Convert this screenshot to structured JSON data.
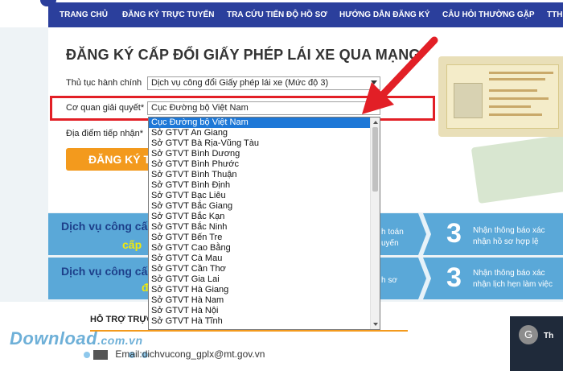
{
  "nav": {
    "items": [
      "TRANG CHỦ",
      "ĐĂNG KÝ TRỰC TUYẾN",
      "TRA CỨU TIẾN ĐỘ HỒ SƠ",
      "HƯỚNG DẪN ĐĂNG KÝ",
      "CÂU HỎI THƯỜNG GẶP",
      "TTH"
    ]
  },
  "form": {
    "title": "ĐĂNG KÝ CẤP ĐỔI GIẤY PHÉP LÁI XE QUA MẠNG",
    "procedure_label": "Thủ tục hành chính",
    "procedure_value": "Dịch vụ công đổi Giấy phép lái xe (Mức độ 3)",
    "agency_label": "Cơ quan giải quyết*",
    "agency_value": "Cục Đường bộ Việt Nam",
    "location_label": "Địa điểm tiếp nhận*",
    "submit_label": "ĐĂNG KÝ TR"
  },
  "dropdown": {
    "options": [
      "Cục Đường bộ Việt Nam",
      "Sở GTVT An Giang",
      "Sở GTVT Bà Rịa-Vũng Tàu",
      "Sở GTVT Bình Dương",
      "Sở GTVT Bình Phước",
      "Sở GTVT Bình Thuận",
      "Sở GTVT Bình Định",
      "Sở GTVT Bạc Liêu",
      "Sở GTVT Bắc Giang",
      "Sở GTVT Bắc Kạn",
      "Sở GTVT Bắc Ninh",
      "Sở GTVT Bến Tre",
      "Sở GTVT Cao Bằng",
      "Sở GTVT Cà Mau",
      "Sở GTVT Cần Thơ",
      "Sở GTVT Gia Lai",
      "Sở GTVT Hà Giang",
      "Sở GTVT Hà Nam",
      "Sở GTVT Hà Nội",
      "Sở GTVT Hà Tĩnh"
    ],
    "selected_index": 0
  },
  "banners": {
    "b1_title": "Dịch vụ công cấp",
    "b1_sub": "cấp",
    "b1_step_text_a": "h toán",
    "b1_step_text_b": "uyến",
    "b1_step_num": "3",
    "b1_step_desc_a": "Nhận thông báo xác",
    "b1_step_desc_b": "nhận hồ sơ hợp lệ",
    "b2_title": "Dịch vụ công cấp",
    "b2_sub": "đ",
    "b2_step_text": "h sơ",
    "b2_step_num": "3",
    "b2_step_desc_a": "Nhận thông báo xác",
    "b2_step_desc_b": "nhận lịch hẹn làm việc"
  },
  "footer": {
    "support_title": "HỖ TRỢ TRỰC T",
    "email_label": "Email:",
    "email_value": "dichvucong_gplx@mt.gov.vn",
    "watermark": "Download",
    "watermark_suffix": ".com.vn",
    "avatar_initial": "G",
    "thumb_label": "Th"
  },
  "colors": {
    "nav_bg": "#2b3f9c",
    "highlight": "#e21f26",
    "accent": "#f39a1d",
    "banner": "#5aa8d8",
    "selected": "#1e78d7"
  }
}
